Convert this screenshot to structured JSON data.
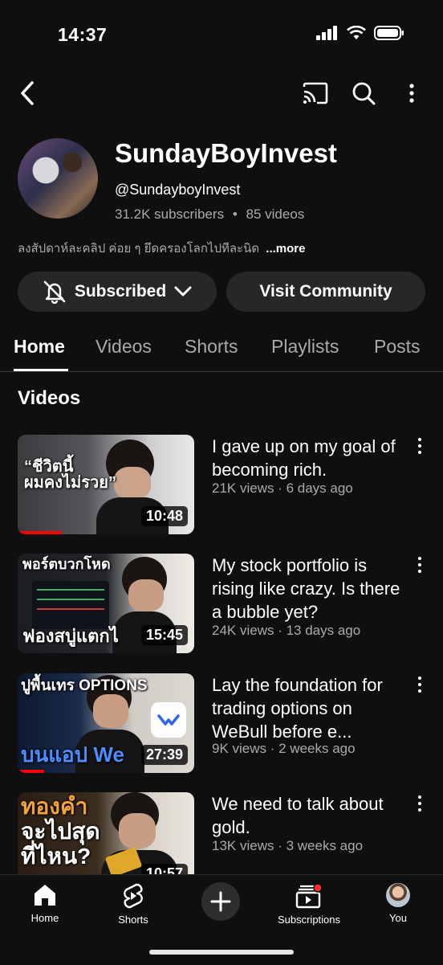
{
  "status_bar": {
    "time": "14:37"
  },
  "channel": {
    "name": "SundayBoyInvest",
    "handle": "@SundayboyInvest",
    "subscribers": "31.2K subscribers",
    "separator": "•",
    "videos_count": "85 videos",
    "description": "ลงสัปดาห์ละคลิป ค่อย ๆ ยึดครองโลกไปทีละนิด",
    "more_label": "...more"
  },
  "buttons": {
    "subscribed_label": "Subscribed",
    "community_label": "Visit Community"
  },
  "tabs": [
    {
      "label": "Home",
      "active": true
    },
    {
      "label": "Videos",
      "active": false
    },
    {
      "label": "Shorts",
      "active": false
    },
    {
      "label": "Playlists",
      "active": false
    },
    {
      "label": "Posts",
      "active": false
    }
  ],
  "section_title": "Videos",
  "videos": [
    {
      "title": "I gave up on my goal of becoming rich.",
      "meta": "21K views · 6 days ago",
      "duration": "10:48",
      "thumb_text": [
        "“ชีวิตนี้",
        "ผมคงไม่รวย”"
      ],
      "watched_fraction": 0.25
    },
    {
      "title": "My stock portfolio is rising like crazy. Is there a bubble yet?",
      "meta": "24K views · 13 days ago",
      "duration": "15:45",
      "thumb_text": [
        "พอร์ตบวกโหด",
        "ฟองสบู่แตกไ"
      ],
      "watched_fraction": 0.0
    },
    {
      "title": "Lay the foundation for trading options on WeBull before e...",
      "meta": "9K views · 2 weeks ago",
      "duration": "27:39",
      "thumb_text": [
        "ปูพื้นเทร OPTIONS",
        "บนแอป We"
      ],
      "watched_fraction": 0.15
    },
    {
      "title": "We need to talk about gold.",
      "meta": "13K views · 3 weeks ago",
      "duration": "10:57",
      "thumb_text": [
        "ทองคำ",
        "จะไปสุด",
        "ที่ไหน?"
      ],
      "watched_fraction": 0.0
    }
  ],
  "bottom_nav": {
    "home": "Home",
    "shorts": "Shorts",
    "subscriptions": "Subscriptions",
    "you": "You"
  },
  "colors": {
    "background": "#0f0f0f",
    "button_bg": "#272727",
    "secondary_text": "#aaaaaa",
    "accent_red": "#ff0000",
    "webull_blue": "#2e64f0",
    "gold": "#d9a520"
  },
  "icons": [
    "back-icon",
    "cast-icon",
    "search-icon",
    "more-vert-icon",
    "bell-off-icon",
    "chevron-down-icon",
    "home-icon",
    "shorts-icon",
    "add-icon",
    "subscriptions-icon"
  ]
}
